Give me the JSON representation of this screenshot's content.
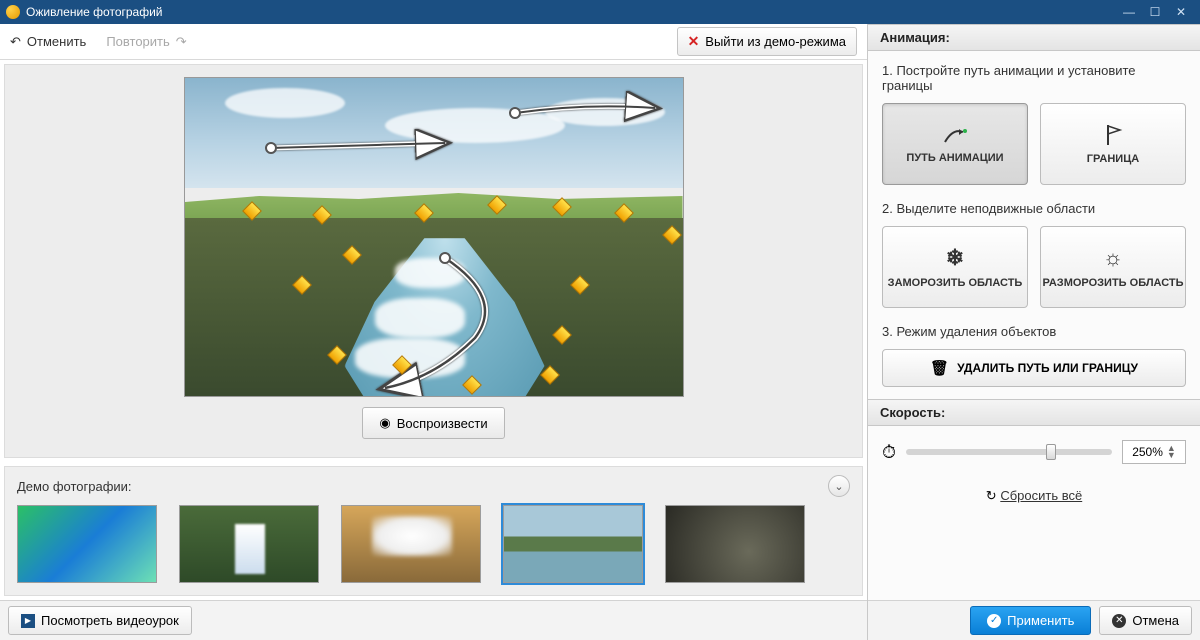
{
  "titlebar": {
    "title": "Оживление фотографий"
  },
  "toolbar": {
    "undo": "Отменить",
    "redo": "Повторить",
    "exit_demo": "Выйти из демо-режима"
  },
  "canvas": {
    "play": "Воспроизвести"
  },
  "demo": {
    "label": "Демо фотографии:"
  },
  "bottom": {
    "tutorial": "Посмотреть видеоурок"
  },
  "panel": {
    "animation_header": "Анимация:",
    "step1": "1. Постройте путь анимации и установите границы",
    "path_btn": "ПУТЬ АНИМАЦИИ",
    "border_btn": "ГРАНИЦА",
    "step2": "2. Выделите неподвижные области",
    "freeze_btn": "ЗАМОРОЗИТЬ ОБЛАСТЬ",
    "unfreeze_btn": "РАЗМОРОЗИТЬ ОБЛАСТЬ",
    "step3": "3. Режим удаления объектов",
    "delete_btn": "УДАЛИТЬ ПУТЬ ИЛИ ГРАНИЦУ",
    "speed_header": "Скорость:",
    "speed_value": "250%",
    "reset": "Сбросить всё",
    "apply": "Применить",
    "cancel": "Отмена"
  }
}
